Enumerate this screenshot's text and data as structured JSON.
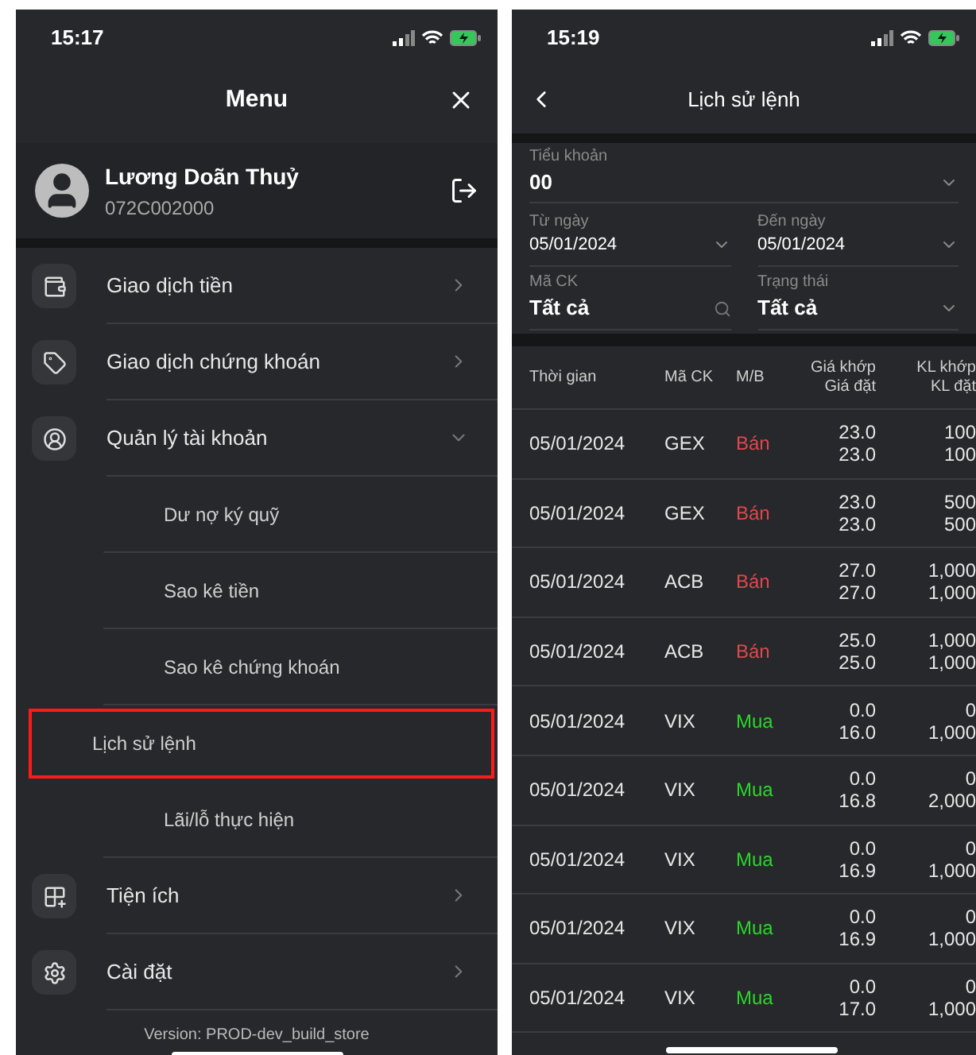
{
  "menu_screen": {
    "status_time": "15:17",
    "title": "Menu",
    "user": {
      "name": "Lương Doãn Thuỷ",
      "account": "072C002000"
    },
    "menu": [
      {
        "label": "Giao dịch tiền",
        "selected": false,
        "expanded": false
      },
      {
        "label": "Giao dịch chứng khoán",
        "selected": false,
        "expanded": false
      },
      {
        "label": "Quản lý tài khoản",
        "selected": false,
        "expanded": true,
        "children": [
          {
            "label": "Dư nợ ký quỹ",
            "selected": false
          },
          {
            "label": "Sao kê tiền",
            "selected": false
          },
          {
            "label": "Sao kê chứng khoán",
            "selected": false
          },
          {
            "label": "Lịch sử lệnh",
            "selected": true
          },
          {
            "label": "Lãi/lỗ thực hiện",
            "selected": false
          }
        ]
      },
      {
        "label": "Tiện ích",
        "selected": false,
        "expanded": false
      },
      {
        "label": "Cài đặt",
        "selected": false,
        "expanded": false
      }
    ],
    "version": "Version: PROD-dev_build_store"
  },
  "history_screen": {
    "status_time": "15:19",
    "title": "Lịch sử lệnh",
    "filters": [
      {
        "label": "Tiểu khoản",
        "value": "00",
        "kind": "select"
      },
      {
        "label": "Từ ngày",
        "value": "05/01/2024",
        "kind": "select"
      },
      {
        "label": "Đến ngày",
        "value": "05/01/2024",
        "kind": "select"
      },
      {
        "label": "Mã CK",
        "value": "Tất cả",
        "kind": "search"
      },
      {
        "label": "Trạng thái",
        "value": "Tất cả",
        "kind": "select"
      }
    ],
    "table": {
      "columns": [
        {
          "lines": [
            "Thời gian"
          ]
        },
        {
          "lines": [
            "Mã CK"
          ]
        },
        {
          "lines": [
            "M/B"
          ]
        },
        {
          "lines": [
            "Giá khớp",
            "Giá đặt"
          ]
        },
        {
          "lines": [
            "KL khớp",
            "KL đặt"
          ]
        }
      ],
      "rows": [
        {
          "time": "05/01/2024",
          "symbol": "GEX",
          "side": "Bán",
          "kind": "sell",
          "match_price": "23.0",
          "order_price": "23.0",
          "match_qty": "100",
          "order_qty": "100"
        },
        {
          "time": "05/01/2024",
          "symbol": "GEX",
          "side": "Bán",
          "kind": "sell",
          "match_price": "23.0",
          "order_price": "23.0",
          "match_qty": "500",
          "order_qty": "500"
        },
        {
          "time": "05/01/2024",
          "symbol": "ACB",
          "side": "Bán",
          "kind": "sell",
          "match_price": "27.0",
          "order_price": "27.0",
          "match_qty": "1,000",
          "order_qty": "1,000"
        },
        {
          "time": "05/01/2024",
          "symbol": "ACB",
          "side": "Bán",
          "kind": "sell",
          "match_price": "25.0",
          "order_price": "25.0",
          "match_qty": "1,000",
          "order_qty": "1,000"
        },
        {
          "time": "05/01/2024",
          "symbol": "VIX",
          "side": "Mua",
          "kind": "buy",
          "match_price": "0.0",
          "order_price": "16.0",
          "match_qty": "0",
          "order_qty": "1,000"
        },
        {
          "time": "05/01/2024",
          "symbol": "VIX",
          "side": "Mua",
          "kind": "buy",
          "match_price": "0.0",
          "order_price": "16.8",
          "match_qty": "0",
          "order_qty": "2,000"
        },
        {
          "time": "05/01/2024",
          "symbol": "VIX",
          "side": "Mua",
          "kind": "buy",
          "match_price": "0.0",
          "order_price": "16.9",
          "match_qty": "0",
          "order_qty": "1,000"
        },
        {
          "time": "05/01/2024",
          "symbol": "VIX",
          "side": "Mua",
          "kind": "buy",
          "match_price": "0.0",
          "order_price": "16.9",
          "match_qty": "0",
          "order_qty": "1,000"
        },
        {
          "time": "05/01/2024",
          "symbol": "VIX",
          "side": "Mua",
          "kind": "buy",
          "match_price": "0.0",
          "order_price": "17.0",
          "match_qty": "0",
          "order_qty": "1,000"
        }
      ]
    }
  }
}
